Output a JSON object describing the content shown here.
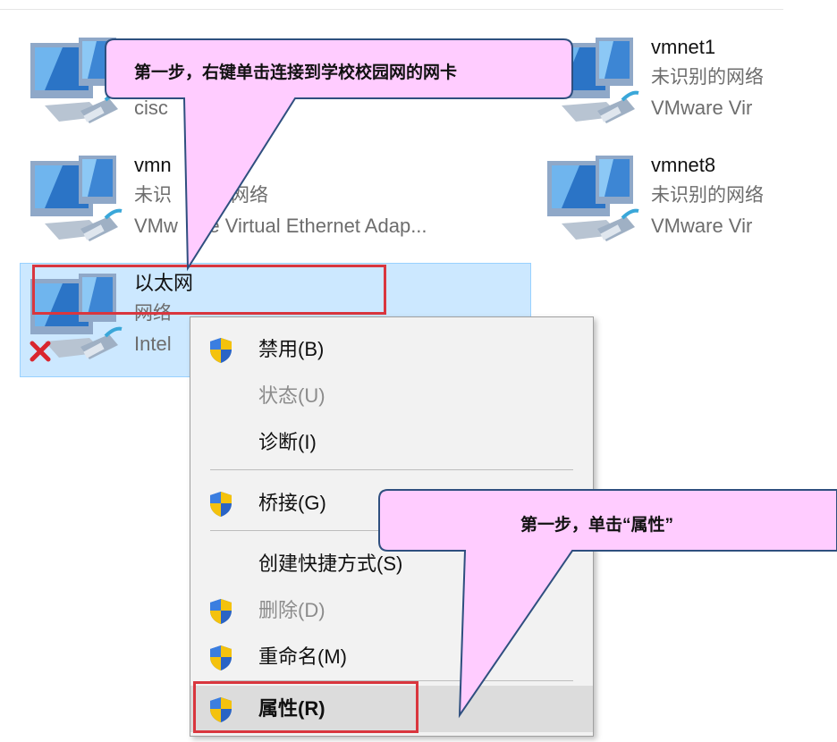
{
  "adapters": [
    {
      "id": "cisco",
      "name": "",
      "status": "",
      "device": "cisc"
    },
    {
      "id": "vmnet1",
      "name": "vmnet1",
      "status": "未识别的网络",
      "device": "VMware Vir"
    },
    {
      "id": "vmnet2",
      "name": "vmn",
      "status": "未识",
      "status_tail": "网络",
      "device": "VMw",
      "device_tail": "re Virtual Ethernet Adap..."
    },
    {
      "id": "vmnet8",
      "name": "vmnet8",
      "status": "未识别的网络",
      "device": "VMware Vir"
    },
    {
      "id": "ethernet",
      "name": "以太网",
      "status": "网络",
      "device": "Intel"
    }
  ],
  "context_menu": {
    "items": [
      {
        "label": "禁用(B)",
        "shield": true,
        "disabled": false
      },
      {
        "label": "状态(U)",
        "shield": false,
        "disabled": true
      },
      {
        "label": "诊断(I)",
        "shield": false,
        "disabled": false
      },
      {
        "label": "桥接(G)",
        "shield": true,
        "disabled": false
      },
      {
        "label": "创建快捷方式(S)",
        "shield": false,
        "disabled": false
      },
      {
        "label": "删除(D)",
        "shield": true,
        "disabled": true
      },
      {
        "label": "重命名(M)",
        "shield": true,
        "disabled": false
      },
      {
        "label": "属性(R)",
        "shield": true,
        "disabled": false,
        "highlighted": true
      }
    ]
  },
  "callouts": {
    "first": "第一步，右键单击连接到学校校园网的网卡",
    "second": "第一步，单击“属性”"
  },
  "colors": {
    "selection": "#cce8ff",
    "highlight_box": "#d9363e",
    "callout_fill": "#ffccff",
    "callout_stroke": "#2f4f7f",
    "shield_blue": "#2a64c5",
    "shield_yellow": "#f4c20d"
  },
  "icons": {
    "adapter": "network-adapter-icon",
    "shield": "uac-shield-icon",
    "error": "red-x-error-icon"
  }
}
